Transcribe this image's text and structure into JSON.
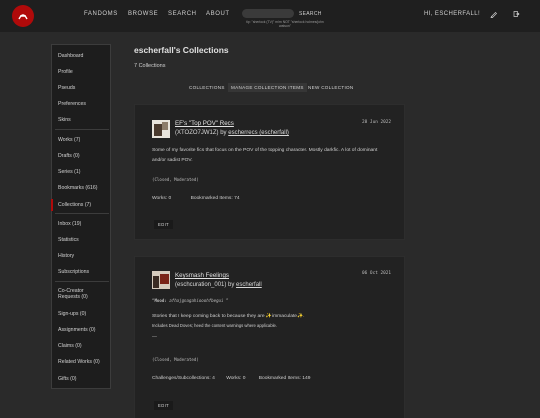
{
  "header": {
    "nav": [
      "FANDOMS",
      "BROWSE",
      "SEARCH",
      "ABOUT"
    ],
    "search_button": "SEARCH",
    "search_tip": "tip: \"sherlock (TV)\" m/m NOT \"sherlock holmes/john watson\"",
    "greeting": "HI, ESCHERFALL!"
  },
  "sidebar": {
    "groups": [
      [
        "Dashboard",
        "Profile",
        "Pseuds",
        "Preferences",
        "Skins"
      ],
      [
        "Works (7)",
        "Drafts (0)",
        "Series (1)",
        "Bookmarks (616)",
        "Collections (7)"
      ],
      [
        "Inbox (19)",
        "Statistics",
        "History",
        "Subscriptions"
      ],
      [
        "Co-Creator Requests (0)",
        "Sign-ups (0)",
        "Assignments (0)",
        "Claims (0)",
        "Related Works (0)",
        "Gifts (0)"
      ]
    ],
    "active": "Collections (7)"
  },
  "main": {
    "title": "escherfall's Collections",
    "count": "7 Collections",
    "subnav": [
      "COLLECTIONS",
      "MANAGE COLLECTION ITEMS",
      "NEW COLLECTION"
    ]
  },
  "collections": [
    {
      "title": "EF's \"Top POV\" Recs",
      "id_line_prefix": "(XTOZO7JW1Z) by ",
      "owner": "escherrecs (escherfall)",
      "date": "28 Jun 2022",
      "description": "Some of my favorite fics that focus on the POV of the topping character. Mostly darkfic. A lot of dominant and/or sadist POV.",
      "status": "(Closed, Moderated)",
      "stats": [
        {
          "label": "Works:",
          "value": "0"
        },
        {
          "label": "Bookmarked Items:",
          "value": "74"
        }
      ],
      "edit": "EDIT"
    },
    {
      "title": "Keysmash Feelings",
      "id_line_prefix": "(eschcuration_001) by ",
      "owner": "escherfall",
      "date": "06 Oct 2021",
      "mood_label": "Mood:",
      "mood_value": "afhajgnagahiooohfbegui",
      "description_pre": "Stories that I keep coming back to because they are ",
      "description_mid": "immaculate",
      "sparkle": "✨",
      "description_note": "Includes Dead Doves; heed the content warnings where applicable.",
      "dash": "—",
      "status": "(Closed, Moderated)",
      "stats": [
        {
          "label": "Challenges/Subcollections:",
          "value": "4"
        },
        {
          "label": "Works:",
          "value": "0"
        },
        {
          "label": "Bookmarked Items:",
          "value": "149"
        }
      ],
      "edit": "EDIT"
    }
  ],
  "colors": {
    "accent": "#b00a0a",
    "background": "#2a2a2a",
    "card": "#222222",
    "header": "#1f1f1f"
  },
  "icons": [
    "ao3-logo-icon",
    "pen-icon",
    "logout-icon"
  ]
}
